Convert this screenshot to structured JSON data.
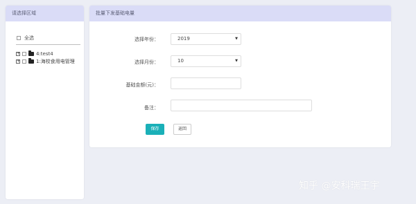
{
  "left_panel": {
    "title": "请选择区域",
    "select_all_label": "全选",
    "tree": [
      {
        "expander": "+",
        "label": "4:test4"
      },
      {
        "expander": "+",
        "label": "1:海校食用电管理"
      }
    ]
  },
  "main_panel": {
    "title": "批量下发基础电量",
    "year": {
      "label": "选择年份：",
      "value": "2019"
    },
    "month": {
      "label": "选择月份：",
      "value": "10"
    },
    "amount": {
      "label": "基础金额(元)：",
      "value": ""
    },
    "remark": {
      "label": "备注：",
      "value": ""
    },
    "save_label": "保存",
    "back_label": "返回"
  },
  "watermark": "知乎 @安科瑞王宇",
  "colors": {
    "header_bg": "#dadcf7",
    "page_bg": "#eceef5",
    "save_button": "#1ab0b8"
  }
}
